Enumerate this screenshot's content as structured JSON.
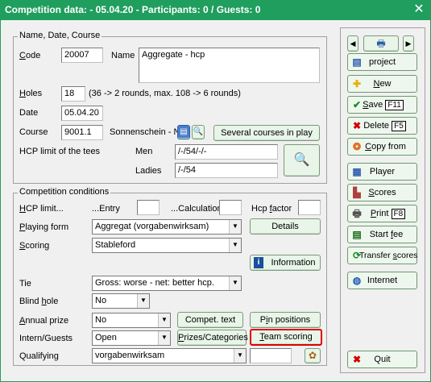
{
  "window": {
    "title": "Competition data:  - 05.04.20 - Participants: 0 / Guests: 0",
    "close": "✕"
  },
  "g1": {
    "title": "Name, Date, Course",
    "code_label": "Code",
    "code_value": "20007",
    "name_label": "Name",
    "name_value": "Aggregate - hcp",
    "holes_label": "Holes",
    "holes_value": "18",
    "holes_hint": "(36 -> 2 rounds, max. 108 -> 6 rounds)",
    "date_label": "Date",
    "date_value": "05.04.20",
    "course_label": "Course",
    "course_value": "9001.1",
    "course_name": "Sonnenschein - N",
    "several_courses": "Several courses in play",
    "hcp_tees_label": "HCP limit of the tees",
    "men_label": "Men",
    "men_value": "/-/54/-/-",
    "ladies_label": "Ladies",
    "ladies_value": "/-/54"
  },
  "g2": {
    "title": "Competition conditions",
    "hcp_limit": "HCP limit...",
    "entry": "...Entry",
    "calculation": "...Calculation",
    "hcp_factor": "Hcp factor",
    "playing_form_label": "Playing form",
    "playing_form_value": "Aggregat (vorgabenwirksam)",
    "details": "Details",
    "scoring_label": "Scoring",
    "scoring_value": "Stableford",
    "information": "Information",
    "tie_label": "Tie",
    "tie_value": "Gross: worse - net: better hcp.",
    "blind_hole_label": "Blind hole",
    "blind_hole_value": "No",
    "annual_prize_label": "Annual prize",
    "annual_prize_value": "No",
    "compet_text": "Compet. text",
    "pin_positions": "Pin positions",
    "intern_label": "Intern/Guests",
    "intern_value": "Open",
    "prizes": "Prizes/Categories",
    "team_scoring": "Team scoring",
    "qualifying_label": "Qualifying",
    "qualifying_value": "vorgabenwirksam"
  },
  "side": {
    "project": "project",
    "new": "New",
    "save": "Save",
    "save_key": "F11",
    "delete": "Delete",
    "delete_key": "F5",
    "copy_from": "Copy from",
    "player": "Player",
    "scores": "Scores",
    "print": "Print",
    "print_key": "F8",
    "start_fee": "Start fee",
    "transfer": "Transfer scores",
    "internet": "Internet",
    "quit": "Quit"
  },
  "colors": {
    "title_bg": "#1f9e5e",
    "highlight": "#e00000"
  }
}
